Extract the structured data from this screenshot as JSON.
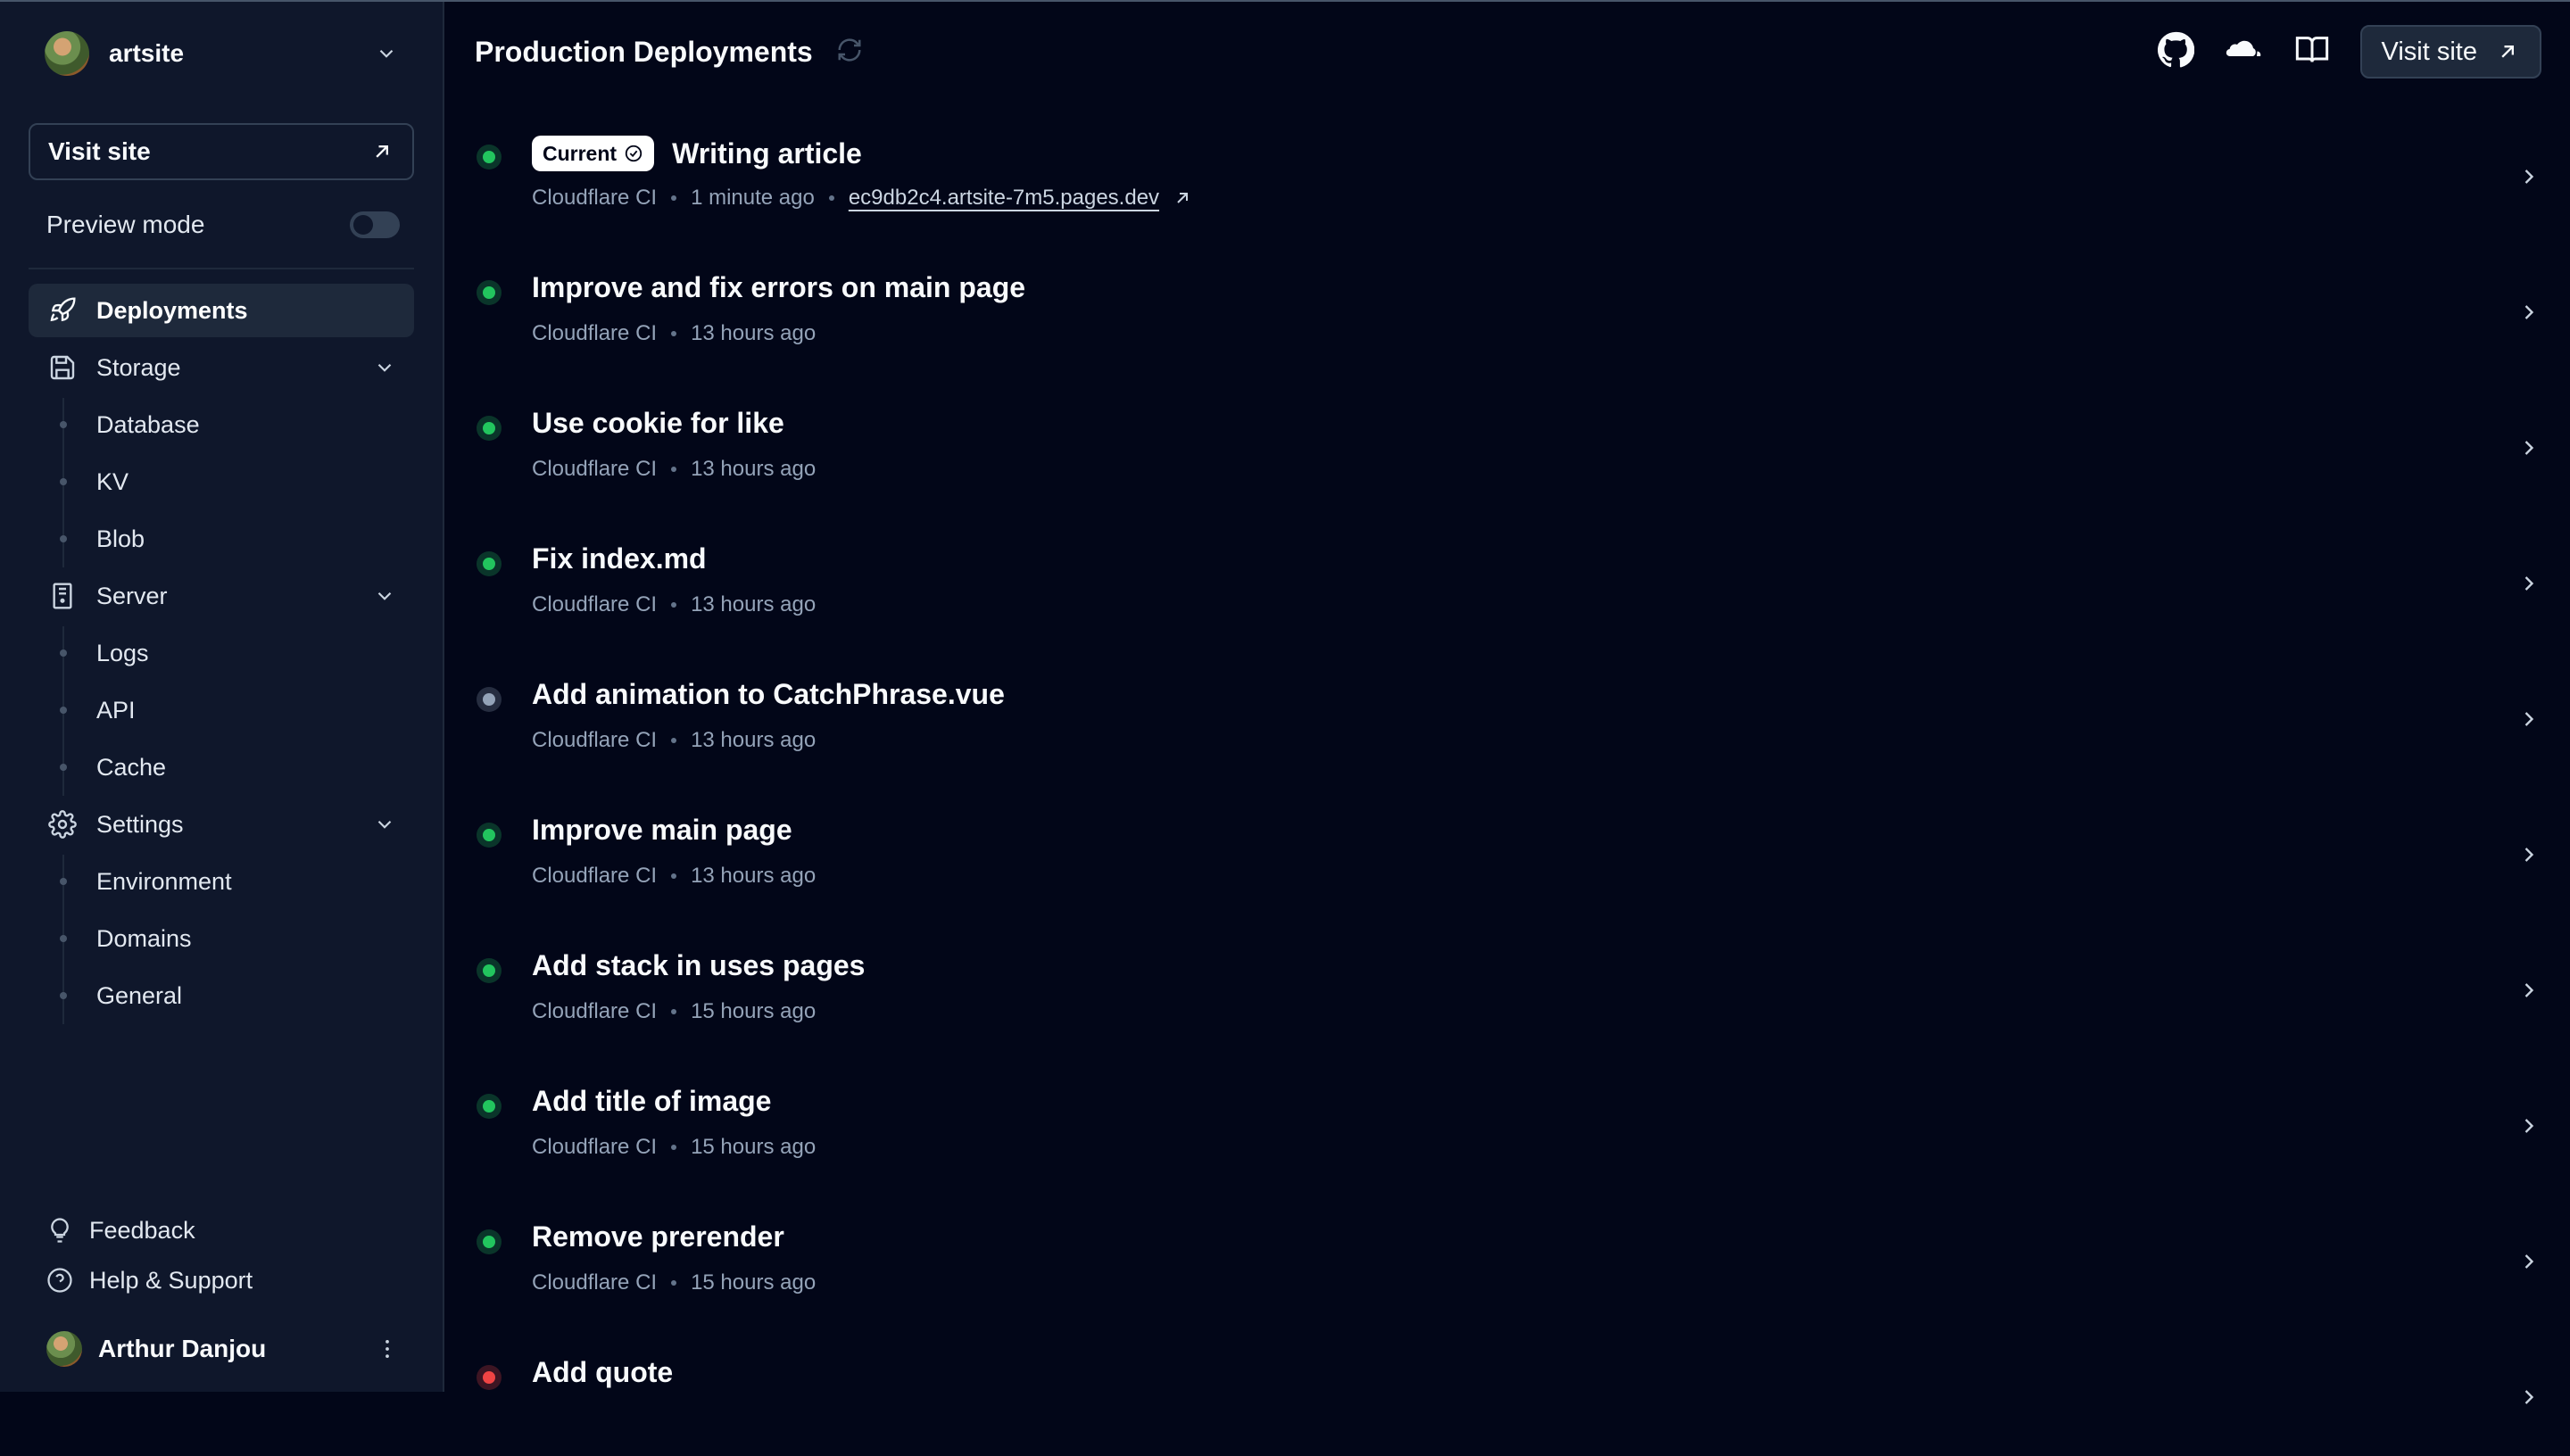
{
  "project": {
    "name": "artsite"
  },
  "sidebar": {
    "visit_site": "Visit site",
    "preview_mode": "Preview mode",
    "nav": {
      "deployments": "Deployments",
      "storage": "Storage",
      "storage_items": [
        "Database",
        "KV",
        "Blob"
      ],
      "server": "Server",
      "server_items": [
        "Logs",
        "API",
        "Cache"
      ],
      "settings": "Settings",
      "settings_items": [
        "Environment",
        "Domains",
        "General"
      ]
    },
    "feedback": "Feedback",
    "help": "Help & Support",
    "user": "Arthur Danjou"
  },
  "header": {
    "title": "Production Deployments",
    "visit_site": "Visit site"
  },
  "colors": {
    "success": "#22c55e",
    "neutral": "#94a3b8",
    "error": "#ef4444",
    "background": "#020618",
    "sidebar": "#0f172b"
  },
  "deployments": [
    {
      "badge": "Current",
      "message": "Writing article",
      "source": "Cloudflare CI",
      "time": "1 minute ago",
      "url": "ec9db2c4.artsite-7m5.pages.dev",
      "status": "success"
    },
    {
      "message": "Improve and fix errors on main page",
      "source": "Cloudflare CI",
      "time": "13 hours ago",
      "status": "success"
    },
    {
      "message": "Use cookie for like",
      "source": "Cloudflare CI",
      "time": "13 hours ago",
      "status": "success"
    },
    {
      "message": "Fix index.md",
      "source": "Cloudflare CI",
      "time": "13 hours ago",
      "status": "success"
    },
    {
      "message": "Add animation to CatchPhrase.vue",
      "source": "Cloudflare CI",
      "time": "13 hours ago",
      "status": "neutral"
    },
    {
      "message": "Improve main page",
      "source": "Cloudflare CI",
      "time": "13 hours ago",
      "status": "success"
    },
    {
      "message": "Add stack in uses pages",
      "source": "Cloudflare CI",
      "time": "15 hours ago",
      "status": "success"
    },
    {
      "message": "Add title of image",
      "source": "Cloudflare CI",
      "time": "15 hours ago",
      "status": "success"
    },
    {
      "message": "Remove prerender",
      "source": "Cloudflare CI",
      "time": "15 hours ago",
      "status": "success"
    },
    {
      "message": "Add quote",
      "source": "",
      "time": "",
      "status": "error"
    }
  ]
}
